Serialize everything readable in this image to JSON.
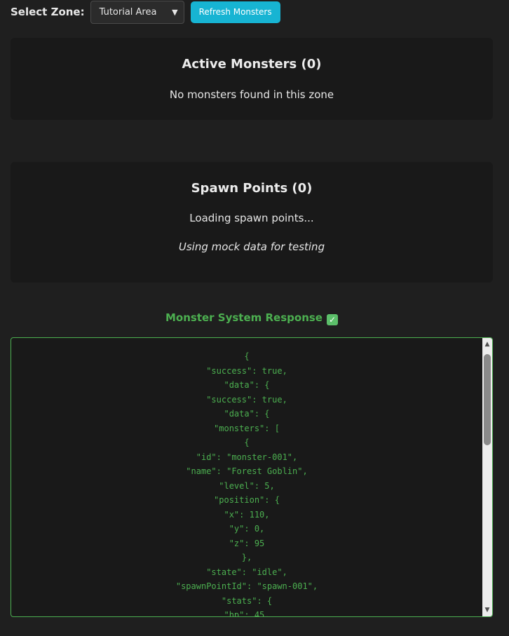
{
  "zone": {
    "label": "Select Zone:",
    "selected": "Tutorial Area",
    "refresh_label": "Refresh Monsters"
  },
  "monsters": {
    "title": "Active Monsters (0)",
    "empty": "No monsters found in this zone"
  },
  "spawn": {
    "title": "Spawn Points (0)",
    "loading": "Loading spawn points...",
    "note": "Using mock data for testing"
  },
  "response": {
    "title": "Monster System Response",
    "status_icon": "check-mark-icon",
    "lines": [
      "{",
      "\"success\": true,",
      "\"data\": {",
      "\"success\": true,",
      "\"data\": {",
      "\"monsters\": [",
      "{",
      "\"id\": \"monster-001\",",
      "\"name\": \"Forest Goblin\",",
      "\"level\": 5,",
      "\"position\": {",
      "\"x\": 110,",
      "\"y\": 0,",
      "\"z\": 95",
      "},",
      "\"state\": \"idle\",",
      "\"spawnPointId\": \"spawn-001\",",
      "\"stats\": {",
      "\"hp\": 45,"
    ]
  },
  "colors": {
    "background": "#1f1f1f",
    "panel": "#191919",
    "accent_cyan": "#17b4d3",
    "accent_green": "#4caf50"
  }
}
